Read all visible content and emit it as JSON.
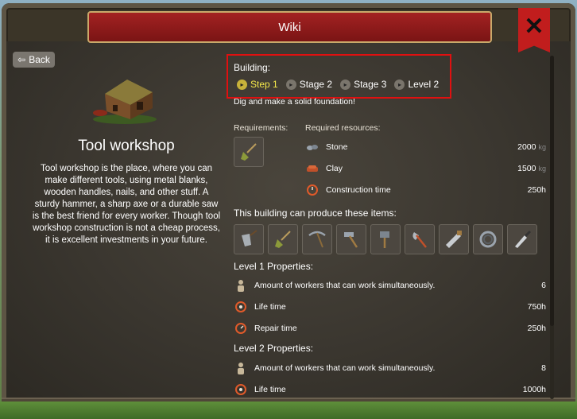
{
  "window": {
    "title": "Wiki",
    "close_icon": "✕"
  },
  "back": {
    "label": "Back",
    "icon": "⇦"
  },
  "building": {
    "name": "Tool workshop",
    "description": "Tool workshop is the place, where you can make different tools, using metal blanks, wooden handles, nails, and other stuff. A sturdy hammer, a sharp axe or a durable saw is the best friend for every worker. Though tool workshop construction is not a cheap process, it is excellent investments in your future."
  },
  "stages": {
    "label": "Building:",
    "items": [
      {
        "label": "Step 1",
        "active": true
      },
      {
        "label": "Stage 2",
        "active": false
      },
      {
        "label": "Stage 3",
        "active": false
      },
      {
        "label": "Level 2",
        "active": false
      }
    ],
    "description": "Dig and make a solid foundation!"
  },
  "requirements": {
    "label": "Requirements:",
    "icon": "shovel-icon"
  },
  "resources": {
    "label": "Required resources:",
    "items": [
      {
        "name": "Stone",
        "value": "2000",
        "unit": "kg",
        "icon": "stone-icon"
      },
      {
        "name": "Clay",
        "value": "1500",
        "unit": "kg",
        "icon": "clay-icon"
      },
      {
        "name": "Construction time",
        "value": "250h",
        "unit": "",
        "icon": "clock-icon"
      }
    ]
  },
  "produces": {
    "label": "This building can produce these items:",
    "items": [
      "shovel-icon",
      "spade-icon",
      "pickaxe-icon",
      "hammer-icon",
      "sledgehammer-icon",
      "axe-icon",
      "saw-icon",
      "sickle-icon",
      "knife-icon"
    ]
  },
  "level1": {
    "label": "Level 1 Properties:",
    "items": [
      {
        "name": "Amount of workers that can work simultaneously.",
        "value": "6",
        "icon": "worker-icon"
      },
      {
        "name": "Life time",
        "value": "750h",
        "icon": "lifetime-icon"
      },
      {
        "name": "Repair time",
        "value": "250h",
        "icon": "repair-icon"
      }
    ]
  },
  "level2": {
    "label": "Level 2 Properties:",
    "items": [
      {
        "name": "Amount of workers that can work simultaneously.",
        "value": "8",
        "icon": "worker-icon"
      },
      {
        "name": "Life time",
        "value": "1000h",
        "icon": "lifetime-icon"
      }
    ]
  },
  "colors": {
    "accent_red": "#a32222",
    "active_step": "#f5e84a",
    "highlight": "#e01010"
  }
}
